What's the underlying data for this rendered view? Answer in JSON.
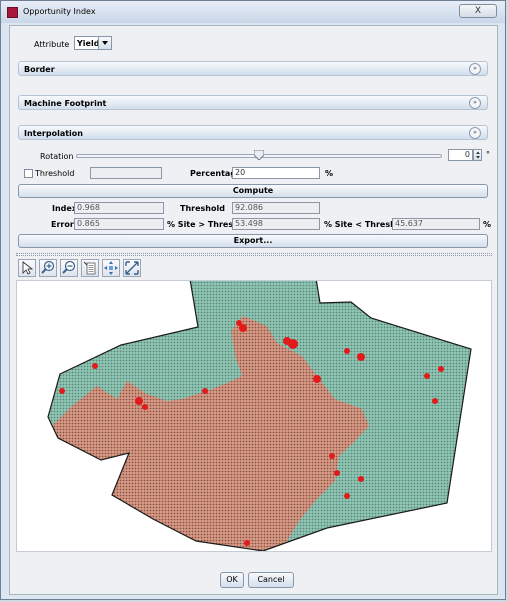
{
  "window": {
    "title": "Opportunity Index",
    "close_symbol": "X"
  },
  "attribute": {
    "label": "Attribute",
    "value": "Yield"
  },
  "sections": [
    {
      "title": "Border"
    },
    {
      "title": "Machine Footprint"
    },
    {
      "title": "Interpolation"
    }
  ],
  "rotation": {
    "label": "Rotation",
    "value": "0",
    "unit": "°",
    "slider_fraction": 0.5
  },
  "threshold": {
    "label": "Threshold",
    "value": ""
  },
  "percentage": {
    "label": "Percentage",
    "value": "20",
    "unit": "%"
  },
  "compute_label": "Compute",
  "results": {
    "index_label": "Index",
    "index_value": "0.968",
    "threshold_label": "Threshold",
    "threshold_value": "92.086",
    "error_label": "Error",
    "error_value": "0.865",
    "site_gt_label": "% Site > Threshold",
    "site_gt_value": "53.498",
    "site_lt_label": "% Site < Threshold",
    "site_lt_value": "45.637",
    "pct_unit": "%"
  },
  "export_label": "Export...",
  "toolbar": [
    {
      "icon": "pointer-icon"
    },
    {
      "icon": "zoom-in-icon"
    },
    {
      "icon": "zoom-out-icon"
    },
    {
      "icon": "layers-icon"
    },
    {
      "icon": "pan-icon"
    },
    {
      "icon": "fit-extent-icon"
    }
  ],
  "colors": {
    "above": "#8fc7b4",
    "below": "#d99a86",
    "hotspot": "#e31a1c",
    "outline": "#1a1a1a"
  },
  "ok_label": "OK",
  "cancel_label": "Cancel"
}
